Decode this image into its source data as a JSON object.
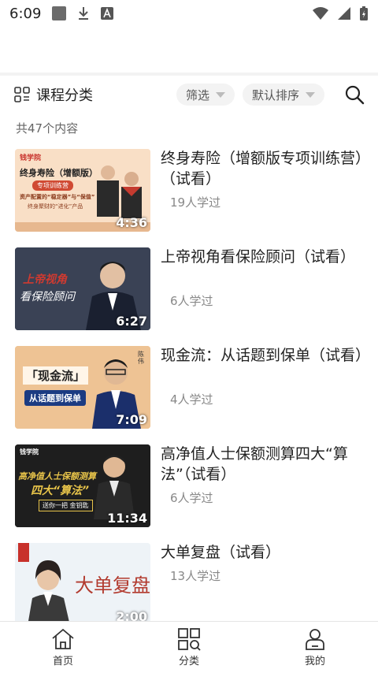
{
  "status": {
    "time": "6:09"
  },
  "filter": {
    "category_title": "课程分类",
    "filter_label": "筛选",
    "sort_label": "默认排序"
  },
  "summary": {
    "count_text": "共47个内容"
  },
  "courses": [
    {
      "title": "终身寿险（增额版专项训练营）（试看）",
      "learners": "19人学过",
      "duration": "4:36",
      "thumb_text": [
        "终身寿险（增额版）",
        "专项训练营",
        "资产配置的“稳定器”与“保值”",
        "终身聚财的“进化”产品"
      ],
      "brand": "钱学院"
    },
    {
      "title": "上帝视角看保险顾问（试看）",
      "learners": "6人学过",
      "duration": "6:27",
      "thumb_text": [
        "上帝视角",
        "看保险顾问"
      ]
    },
    {
      "title": "现金流：从话题到保单（试看）",
      "learners": "4人学过",
      "duration": "7:09",
      "thumb_text": [
        "「现金流」",
        "从话题到保单",
        "陈伟"
      ]
    },
    {
      "title": "高净值人士保额测算四大“算法”（试看）",
      "learners": "6人学过",
      "duration": "11:34",
      "thumb_text": [
        "高净值人士保额测算",
        "四大“算法”",
        "送你一把 金钥匙"
      ],
      "brand": "钱学院"
    },
    {
      "title": "大单复盘（试看）",
      "learners": "13人学过",
      "duration": "2:00",
      "thumb_text": [
        "大单复盘"
      ]
    }
  ],
  "nav": {
    "home": "首页",
    "category": "分类",
    "mine": "我的"
  },
  "colors": {
    "accent_red": "#c8312b",
    "dark_blue": "#1f2a44"
  }
}
